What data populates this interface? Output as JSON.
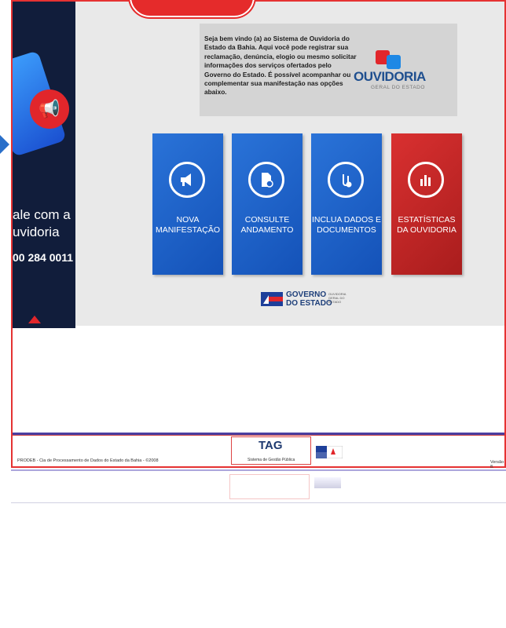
{
  "welcome": {
    "text": "Seja bem vindo (a) ao Sistema de Ouvidoria do Estado da Bahia. Aqui você pode registrar sua reclamação, denúncia, elogio ou mesmo solicitar informações dos serviços ofertados pelo Governo do Estado. É possível acompanhar ou complementar sua manifestação nas opções abaixo."
  },
  "logo": {
    "word": "OUVIDORIA",
    "sub": "GERAL DO ESTADO"
  },
  "banner": {
    "line1": "ale com a",
    "line2": "uvidoria",
    "phone": "00 284 0011"
  },
  "tiles": [
    {
      "label": "NOVA MANIFESTAÇÃO",
      "icon": "megaphone-icon",
      "color": "#1f63cc"
    },
    {
      "label": "CONSULTE ANDAMENTO",
      "icon": "document-gear-icon",
      "color": "#1f63cc"
    },
    {
      "label": "INCLUA DADOS E DOCUMENTOS",
      "icon": "paperclip-icon",
      "color": "#1f63cc"
    },
    {
      "label": "ESTATÍSTICAS DA OUVIDORIA",
      "icon": "bar-chart-icon",
      "color": "#c62828"
    }
  ],
  "gov_logo": {
    "text1": "GOVERNO",
    "text2": "DO ESTADO",
    "small1": "OUVIDORIA",
    "small2": "GERAL DO ESTADO"
  },
  "footer": {
    "copyright": "PRODEB - Cia de Processamento de Dados do Estado da Bahia - ©2008",
    "version": "Versão 8.",
    "tag": "TAG",
    "tag_sub": "Sistema de Gestão Pública"
  },
  "colors": {
    "accent_red": "#e52b2b",
    "tile_blue": "#1f63cc",
    "tile_red": "#c62828",
    "banner_navy": "#111d3b"
  }
}
